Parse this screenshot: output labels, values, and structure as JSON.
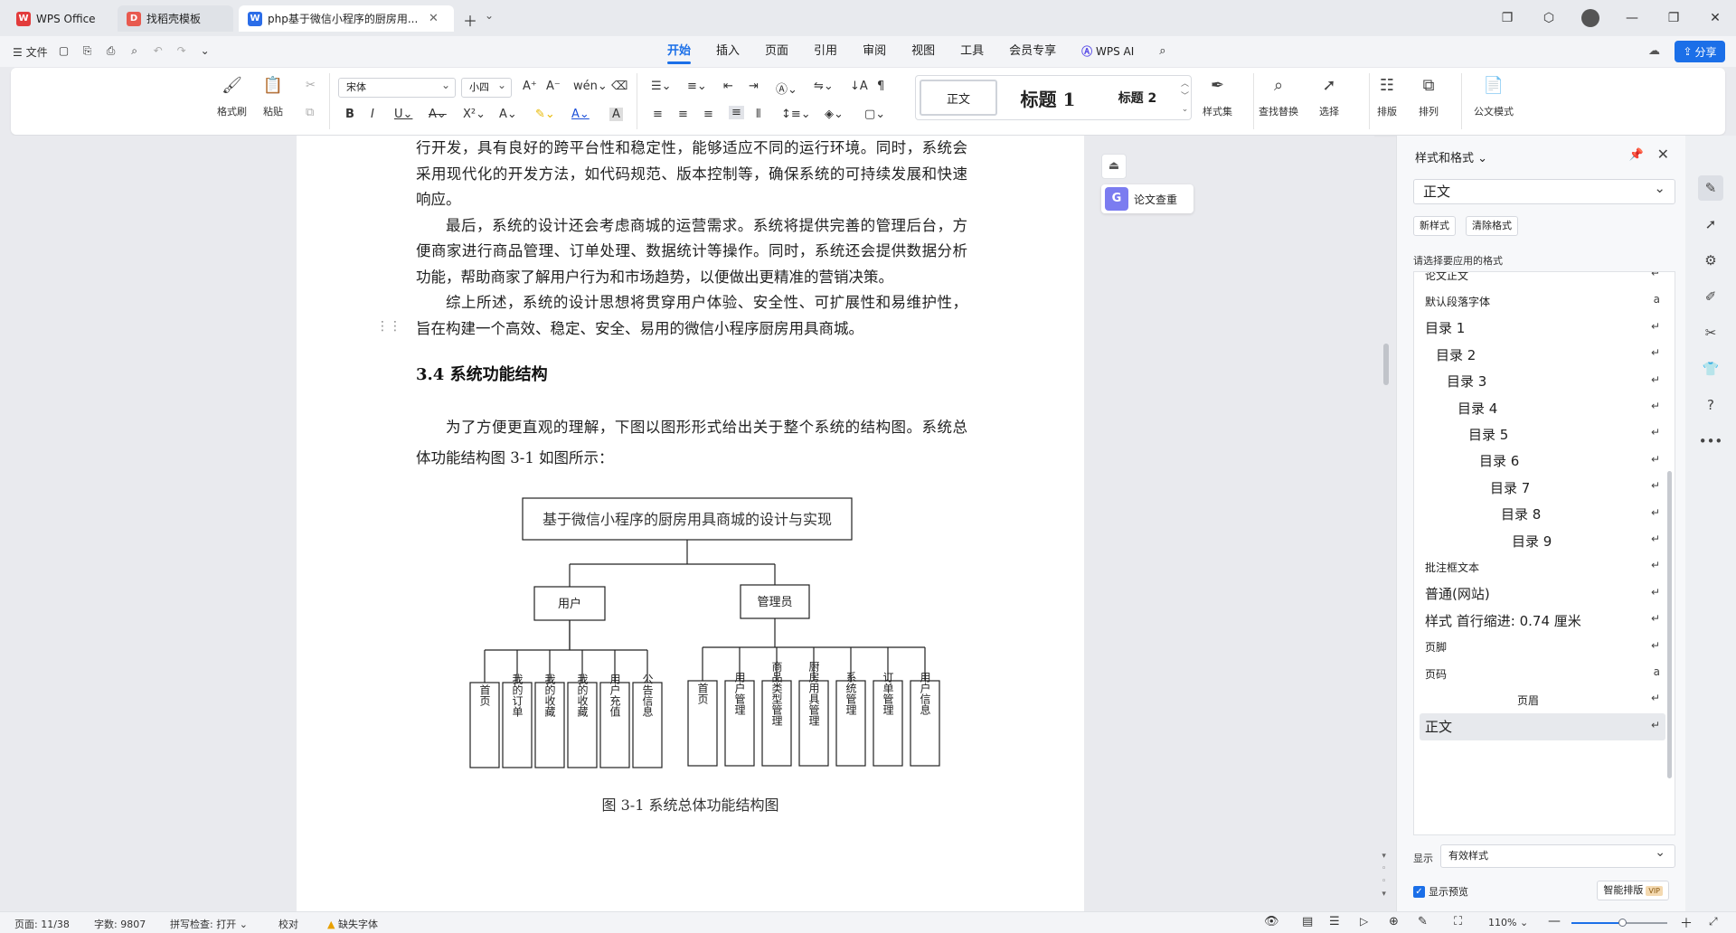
{
  "tabs": [
    {
      "label": "WPS Office",
      "icon": "wps-logo-icon",
      "color": "#e23b3b"
    },
    {
      "label": "找稻壳模板",
      "icon": "docer-icon",
      "color": "#e85a4f"
    },
    {
      "label": "php基于微信小程序的厨房用...",
      "icon": "word-doc-icon",
      "color": "#2b6de8"
    }
  ],
  "menu": {
    "file": "文件",
    "tabs": [
      "开始",
      "插入",
      "页面",
      "引用",
      "审阅",
      "视图",
      "工具",
      "会员专享"
    ],
    "active_tab": "开始",
    "wps_ai": "WPS AI",
    "share": "分享"
  },
  "ribbon": {
    "format_painter": "格式刷",
    "paste": "粘贴",
    "font_name": "宋体",
    "font_size": "小四",
    "styles": [
      "正文",
      "标题 1",
      "标题 2"
    ],
    "style_set": "样式集",
    "find_replace": "查找替换",
    "select": "选择",
    "layout": "排版",
    "arrange": "排列",
    "doc_mode": "公文模式"
  },
  "document": {
    "paragraphs": [
      "行开发，具有良好的跨平台性和稳定性，能够适应不同的运行环境。同时，系统会采用现代化的开发方法，如代码规范、版本控制等，确保系统的可持续发展和快速响应。",
      "最后，系统的设计还会考虑商城的运营需求。系统将提供完善的管理后台，方便商家进行商品管理、订单处理、数据统计等操作。同时，系统还会提供数据分析功能，帮助商家了解用户行为和市场趋势，以便做出更精准的营销决策。",
      "综上所述，系统的设计思想将贯穿用户体验、安全性、可扩展性和易维护性，旨在构建一个高效、稳定、安全、易用的微信小程序厨房用具商城。"
    ],
    "heading": "3.4 系统功能结构",
    "intro": "为了方便更直观的理解，下图以图形形式给出关于整个系统的结构图。系统总体功能结构图 3-1 如图所示：",
    "chart": {
      "root": "基于微信小程序的厨房用具商城的设计与实现",
      "user": "用户",
      "admin": "管理员",
      "user_children": [
        "首页",
        "我的订单",
        "我的收藏",
        "我的收藏",
        "用户充值",
        "公告信息"
      ],
      "admin_children": [
        "首页",
        "用户管理",
        "商品类型管理",
        "厨房用具管理",
        "系统管理",
        "订单管理",
        "用户信息"
      ]
    },
    "caption": "图 3-1 系统总体功能结构图"
  },
  "float_tools": {
    "lunwen": "论文查重"
  },
  "styles_panel": {
    "title": "样式和格式",
    "current": "正文",
    "new_style": "新样式",
    "clear_format": "清除格式",
    "hint": "请选择要应用的格式",
    "items": [
      {
        "label": "论文正文",
        "indent": 0,
        "size": 12,
        "mark": "↵"
      },
      {
        "label": "默认段落字体",
        "indent": 0,
        "size": 12,
        "mark": "a"
      },
      {
        "label": "目录 1",
        "indent": 0,
        "size": 15,
        "mark": "↵"
      },
      {
        "label": "目录 2",
        "indent": 12,
        "size": 15,
        "mark": "↵"
      },
      {
        "label": "目录 3",
        "indent": 24,
        "size": 15,
        "mark": "↵"
      },
      {
        "label": "目录 4",
        "indent": 36,
        "size": 15,
        "mark": "↵"
      },
      {
        "label": "目录 5",
        "indent": 48,
        "size": 15,
        "mark": "↵"
      },
      {
        "label": "目录 6",
        "indent": 60,
        "size": 15,
        "mark": "↵"
      },
      {
        "label": "目录 7",
        "indent": 72,
        "size": 15,
        "mark": "↵"
      },
      {
        "label": "目录 8",
        "indent": 84,
        "size": 15,
        "mark": "↵"
      },
      {
        "label": "目录 9",
        "indent": 96,
        "size": 15,
        "mark": "↵"
      },
      {
        "label": "批注框文本",
        "indent": 0,
        "size": 12,
        "mark": "↵"
      },
      {
        "label": "普通(网站)",
        "indent": 0,
        "size": 15,
        "mark": "↵"
      },
      {
        "label": "样式 首行缩进: 0.74 厘米",
        "indent": 0,
        "size": 15,
        "mark": "↵"
      },
      {
        "label": "页脚",
        "indent": 0,
        "size": 12,
        "mark": "↵"
      },
      {
        "label": "页码",
        "indent": 0,
        "size": 12,
        "mark": "a"
      },
      {
        "label": "页眉",
        "indent": 102,
        "size": 12,
        "mark": "↵"
      },
      {
        "label": "正文",
        "indent": 0,
        "size": 15,
        "mark": "↵",
        "selected": true
      }
    ],
    "show_label": "显示",
    "show_value": "有效样式",
    "preview_label": "显示预览",
    "smart_layout": "智能排版",
    "vip": "VIP"
  },
  "status": {
    "page": "页面: 11/38",
    "words": "字数: 9807",
    "spell": "拼写检查: 打开",
    "proof": "校对",
    "missing_font": "缺失字体",
    "zoom": "110%"
  },
  "colors": {
    "accent": "#1b6fe8"
  }
}
